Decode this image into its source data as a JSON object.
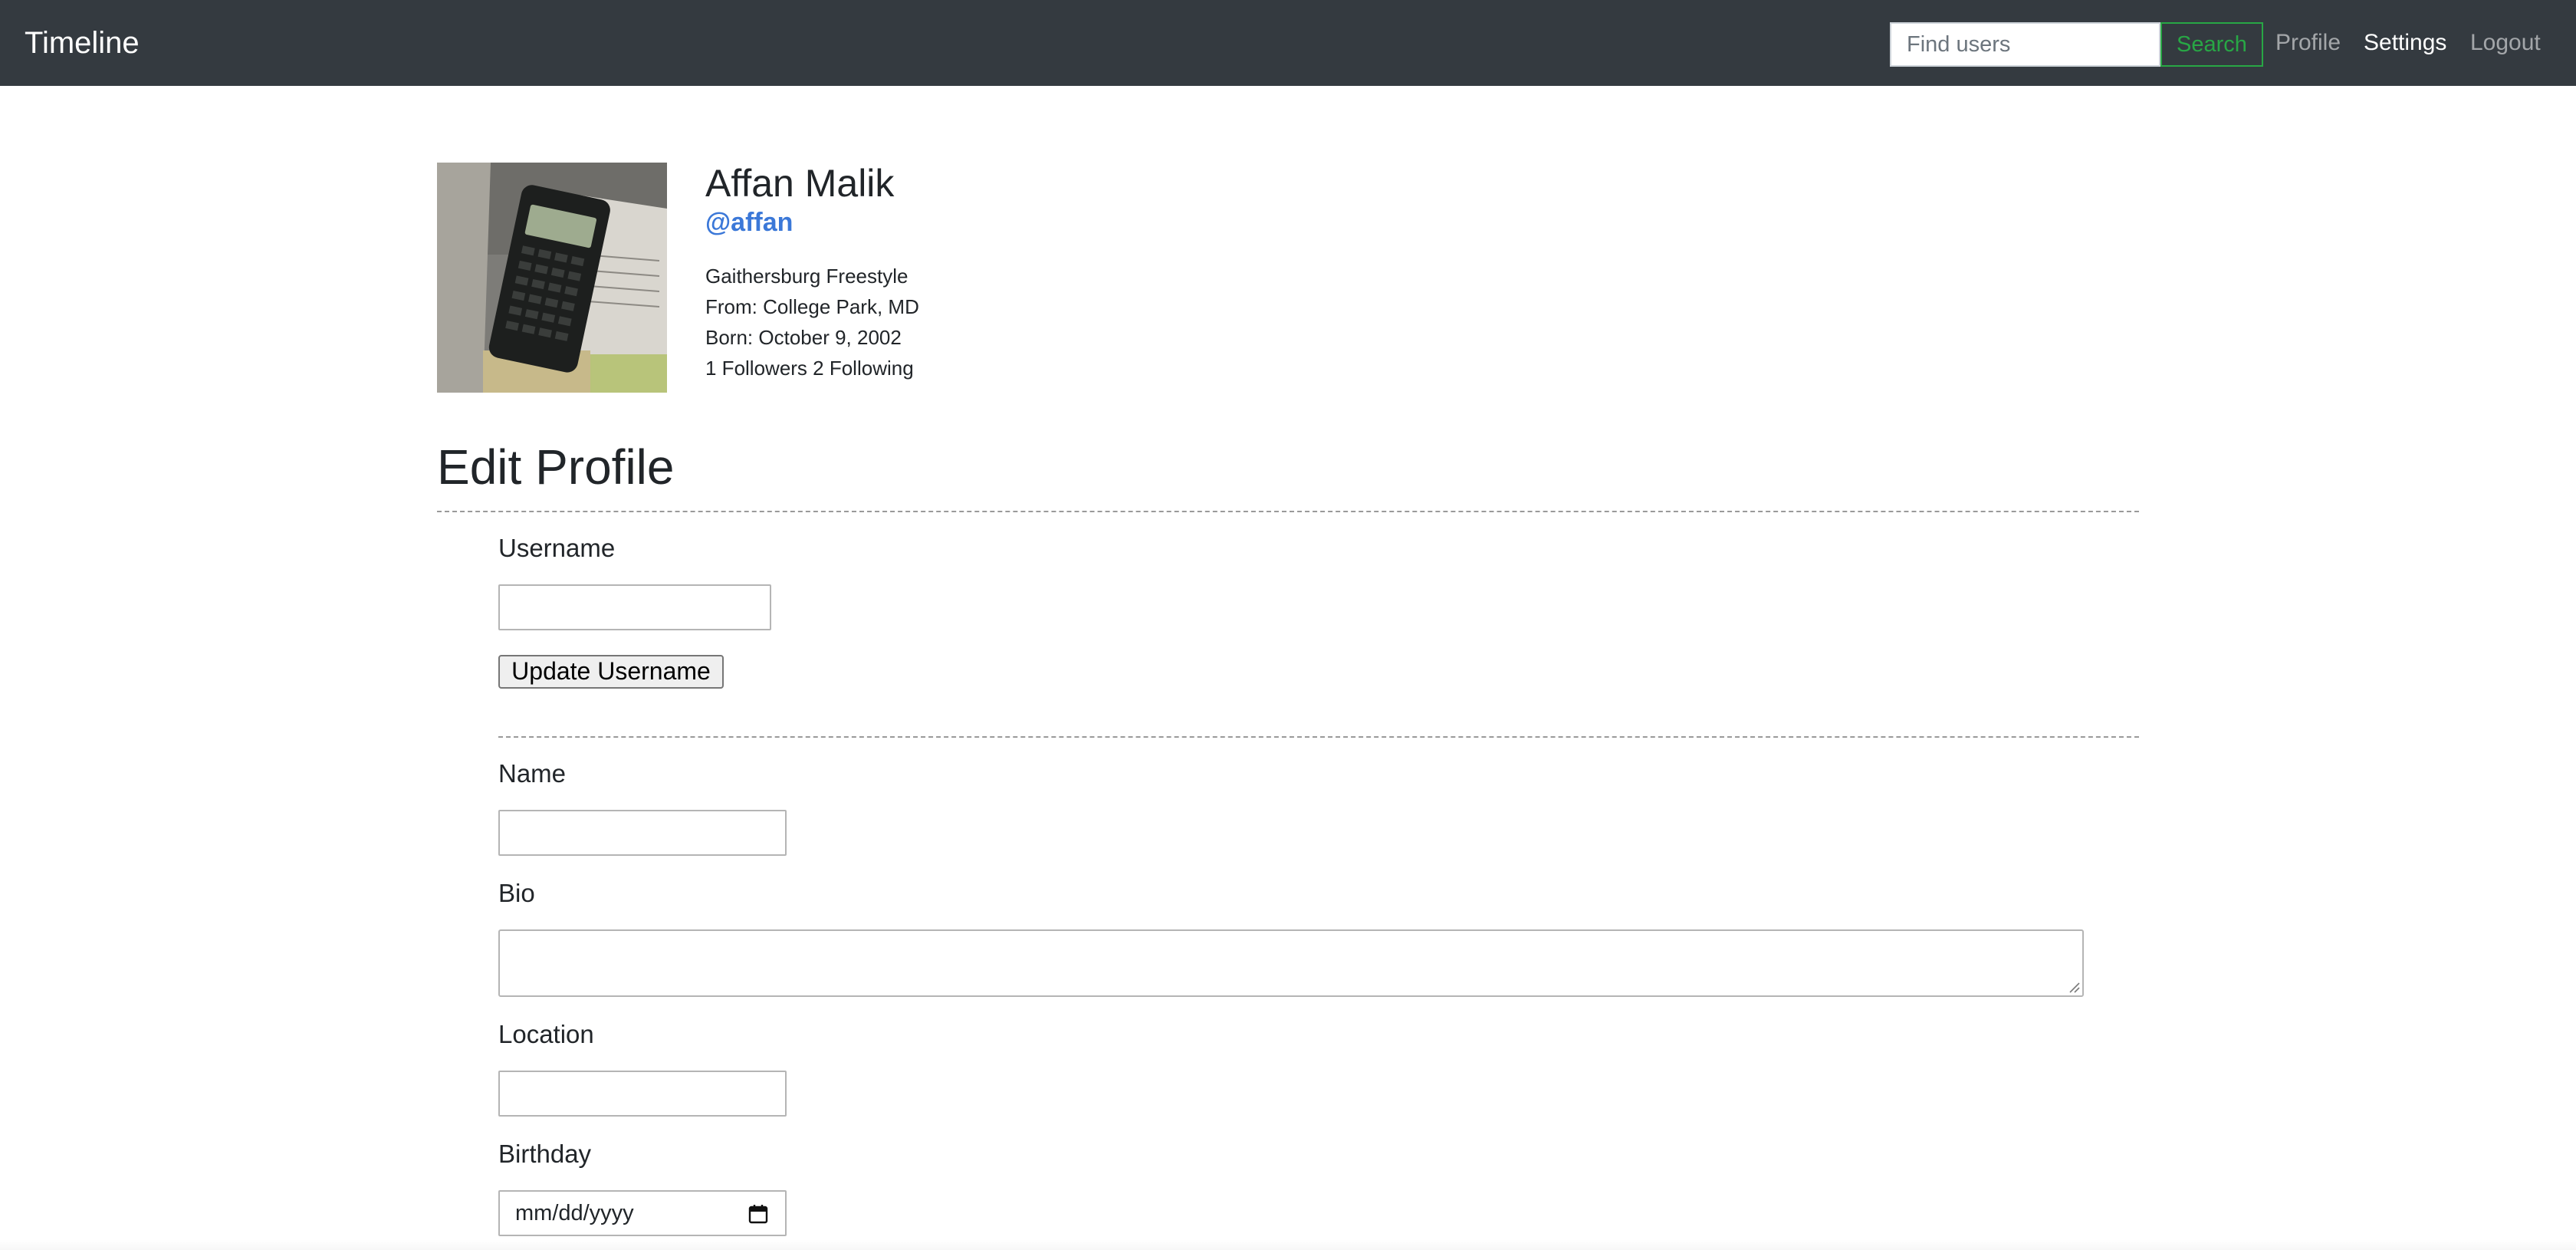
{
  "navbar": {
    "brand": "Timeline",
    "search_placeholder": "Find users",
    "search_button": "Search",
    "links": {
      "profile": "Profile",
      "settings": "Settings",
      "logout": "Logout"
    }
  },
  "profile": {
    "name": "Affan Malik",
    "handle": "@affan",
    "bio": "Gaithersburg Freestyle",
    "location": "From: College Park, MD",
    "birthday": "Born: October 9, 2002",
    "follow_stats": "1 Followers 2 Following",
    "avatar_icon": "calculator-photo"
  },
  "edit_profile": {
    "title": "Edit Profile",
    "username_label": "Username",
    "update_username_button": "Update Username",
    "name_label": "Name",
    "bio_label": "Bio",
    "location_label": "Location",
    "birthday_label": "Birthday",
    "birthday_placeholder": "mm/dd/yyyy"
  },
  "colors": {
    "navbar_bg": "#343a40",
    "accent_green": "#28a745",
    "handle_blue": "#3b78d8"
  }
}
